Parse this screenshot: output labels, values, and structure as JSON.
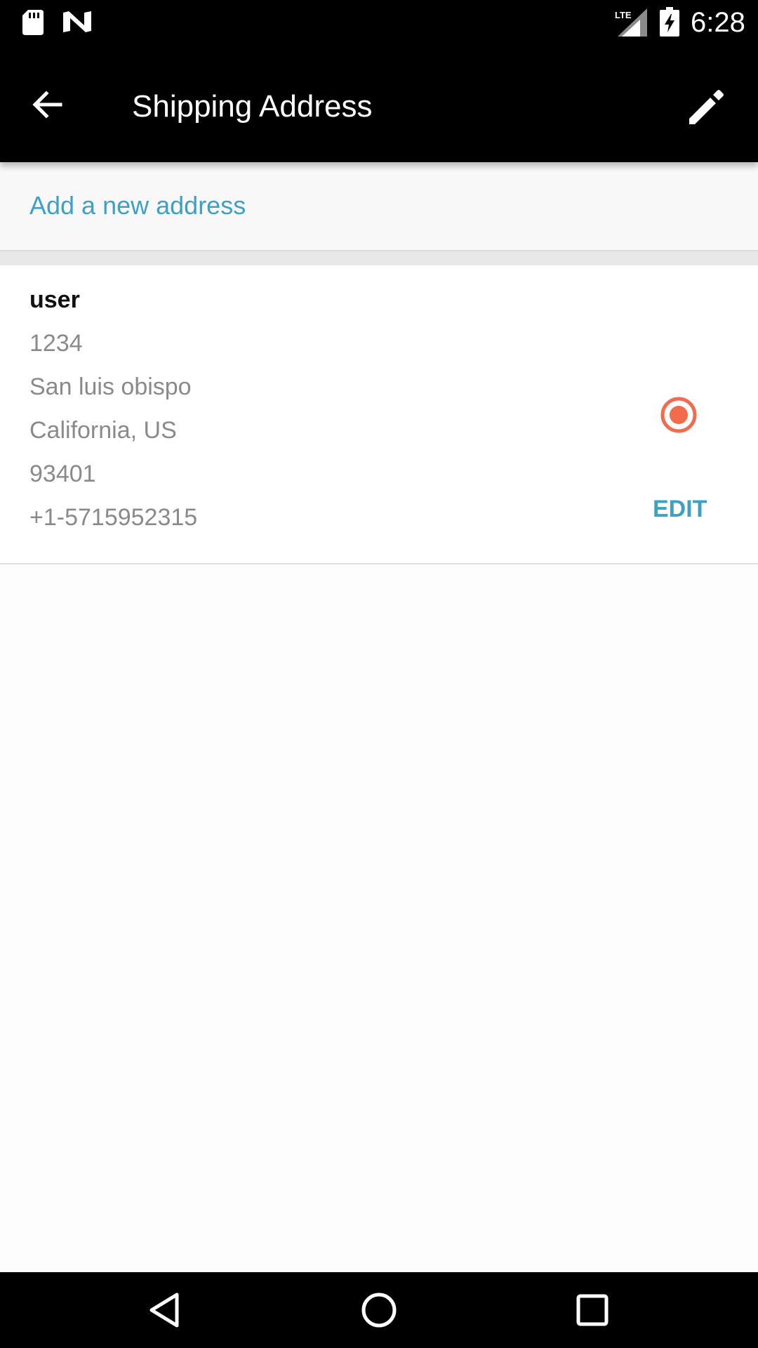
{
  "status_bar": {
    "time": "6:28",
    "network": "LTE",
    "icons": [
      "sd-card-icon",
      "n-logo-icon",
      "lte-signal-icon",
      "battery-charging-icon"
    ]
  },
  "toolbar": {
    "title": "Shipping Address",
    "back_icon": "arrow-back-icon",
    "edit_icon": "pencil-icon"
  },
  "add_address": {
    "label": "Add a new address"
  },
  "address": {
    "name": "user",
    "street": "1234",
    "city": "San luis obispo",
    "state_country": "California, US",
    "zip": "93401",
    "phone": "+1-5715952315",
    "selected": true,
    "edit_label": "EDIT"
  },
  "colors": {
    "accent": "#3ea1c4",
    "radio": "#f26b4a",
    "bar": "#000000"
  },
  "nav_bar": {
    "icons": [
      "nav-back-icon",
      "nav-home-icon",
      "nav-recents-icon"
    ]
  }
}
